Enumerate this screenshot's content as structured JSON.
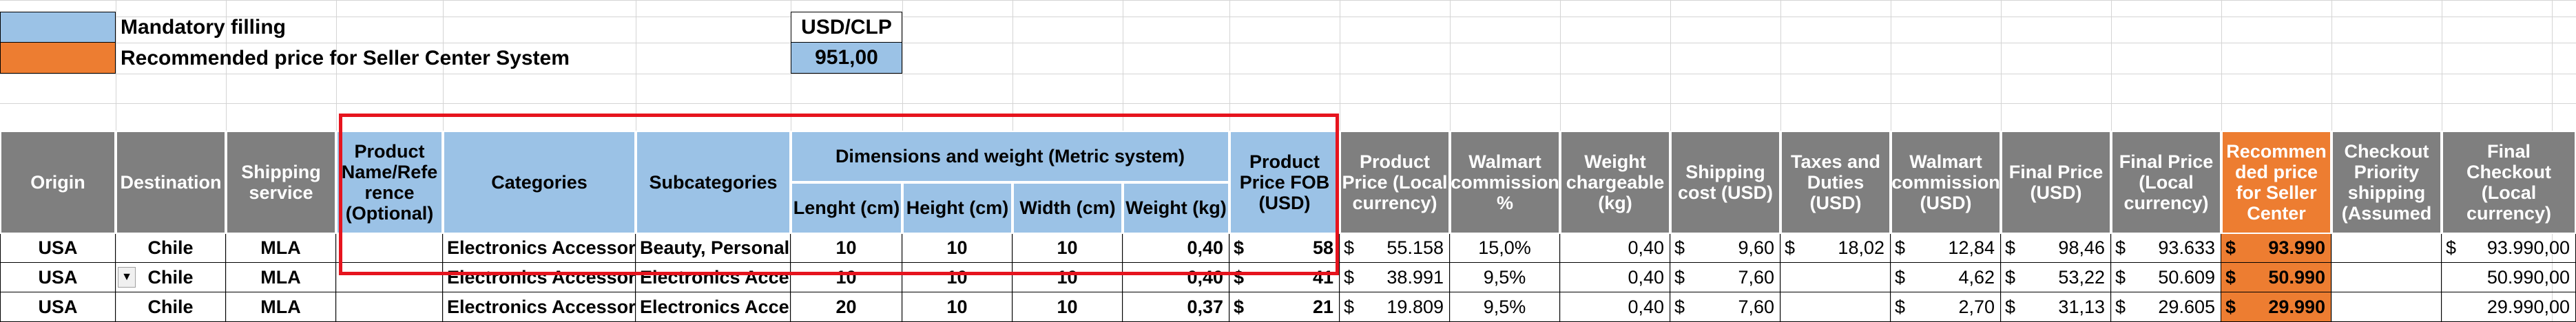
{
  "legend": {
    "mandatory": {
      "label": "Mandatory filling",
      "color": "#9bc2e6"
    },
    "recommended": {
      "label": "Recommended price for Seller Center System",
      "color": "#ed7d31"
    }
  },
  "rate": {
    "label": "USD/CLP",
    "value": "951,00"
  },
  "headers": {
    "origin": "Origin",
    "destination": "Destination",
    "shipping_service": "Shipping service",
    "product_name": "Product Name/Refe rence (Optional)",
    "categories": "Categories",
    "subcategories": "Subcategories",
    "dimensions_group": "Dimensions and weight (Metric system)",
    "length": "Lenght (cm)",
    "height": "Height (cm)",
    "width": "Width (cm)",
    "weight": "Weight (kg)",
    "price_fob": "Product Price FOB (USD)",
    "price_local": "Product Price (Local currency)",
    "walmart_commission_pct": "Walmart commission %",
    "weight_chargeable": "Weight chargeable (kg)",
    "shipping_cost": "Shipping cost (USD)",
    "taxes": "Taxes and Duties (USD)",
    "walmart_commission_usd": "Walmart commission (USD)",
    "final_price_usd": "Final Price (USD)",
    "final_price_local": "Final Price (Local currency)",
    "recommended_price": "Recommen ded price for Seller Center",
    "checkout_priority": "Checkout Priority shipping (Assumed",
    "final_checkout": "Final Checkout (Local currency)"
  },
  "currency_symbol": "$",
  "rows": [
    {
      "origin": "USA",
      "destination": "Chile",
      "service": "MLA",
      "product_name": "",
      "category": "Electronics Accessories",
      "subcategory": "Beauty, Personal C",
      "length": "10",
      "height": "10",
      "width": "10",
      "weight": "0,40",
      "price_fob": "58",
      "price_local": "55.158",
      "commission_pct": "15,0%",
      "weight_chargeable": "0,40",
      "shipping_cost": "9,60",
      "taxes": "18,02",
      "commission_usd": "12,84",
      "final_usd": "98,46",
      "final_local": "93.633",
      "recommended": "93.990",
      "checkout": "",
      "final_checkout": "93.990,00"
    },
    {
      "origin": "USA",
      "destination": "Chile",
      "service": "MLA",
      "product_name": "",
      "category": "Electronics Accessories",
      "subcategory": "Electronics Accesso",
      "length": "10",
      "height": "10",
      "width": "10",
      "weight": "0,40",
      "price_fob": "41",
      "price_local": "38.991",
      "commission_pct": "9,5%",
      "weight_chargeable": "0,40",
      "shipping_cost": "7,60",
      "taxes": "",
      "commission_usd": "4,62",
      "final_usd": "53,22",
      "final_local": "50.609",
      "recommended": "50.990",
      "checkout": "",
      "final_checkout": "50.990,00"
    },
    {
      "origin": "USA",
      "destination": "Chile",
      "service": "MLA",
      "product_name": "",
      "category": "Electronics Accessories",
      "subcategory": "Electronics Accesso",
      "length": "20",
      "height": "10",
      "width": "10",
      "weight": "0,37",
      "price_fob": "21",
      "price_local": "19.809",
      "commission_pct": "9,5%",
      "weight_chargeable": "0,40",
      "shipping_cost": "7,60",
      "taxes": "",
      "commission_usd": "2,70",
      "final_usd": "31,13",
      "final_local": "29.605",
      "recommended": "29.990",
      "checkout": "",
      "final_checkout": "29.990,00"
    }
  ]
}
